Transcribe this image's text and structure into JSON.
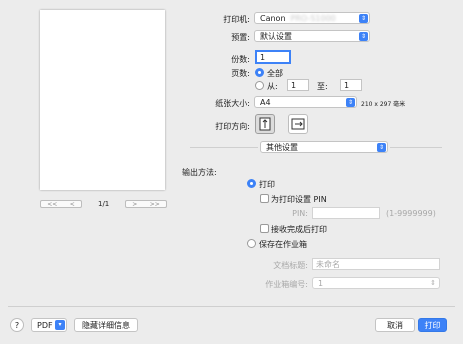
{
  "preview": {
    "page_indicator": "1/1",
    "first": "<<",
    "prev": "<",
    "next": ">",
    "last": ">>"
  },
  "printer": {
    "label": "打印机:",
    "value": "Canon",
    "value_blurred": "PRO-S1000"
  },
  "presets": {
    "label": "预置:",
    "value": "默认设置"
  },
  "copies": {
    "label": "份数:",
    "value": "1"
  },
  "pages": {
    "label": "页数:",
    "all_label": "全部",
    "from_label": "从:",
    "from_value": "1",
    "to_label": "至:",
    "to_value": "1"
  },
  "paper_size": {
    "label": "纸张大小:",
    "value": "A4",
    "dimensions": "210 x 297 毫米"
  },
  "orientation": {
    "label": "打印方向:"
  },
  "section": {
    "value": "其他设置"
  },
  "output": {
    "label": "输出方法:",
    "print_label": "打印",
    "set_pin_label": "为打印设置 PIN",
    "pin_label": "PIN:",
    "pin_range": "(1-9999999)",
    "print_after_receive_label": "接收完成后打印",
    "save_mailbox_label": "保存在作业箱",
    "doc_title_label": "文档标题:",
    "doc_title_value": "未命名",
    "mailbox_num_label": "作业箱编号:",
    "mailbox_num_value": "1"
  },
  "footer": {
    "help": "?",
    "pdf": "PDF",
    "hide_details": "隐藏详细信息",
    "cancel": "取消",
    "print": "打印"
  },
  "colors": {
    "accent": "#3d82f7",
    "background": "#ececec"
  }
}
